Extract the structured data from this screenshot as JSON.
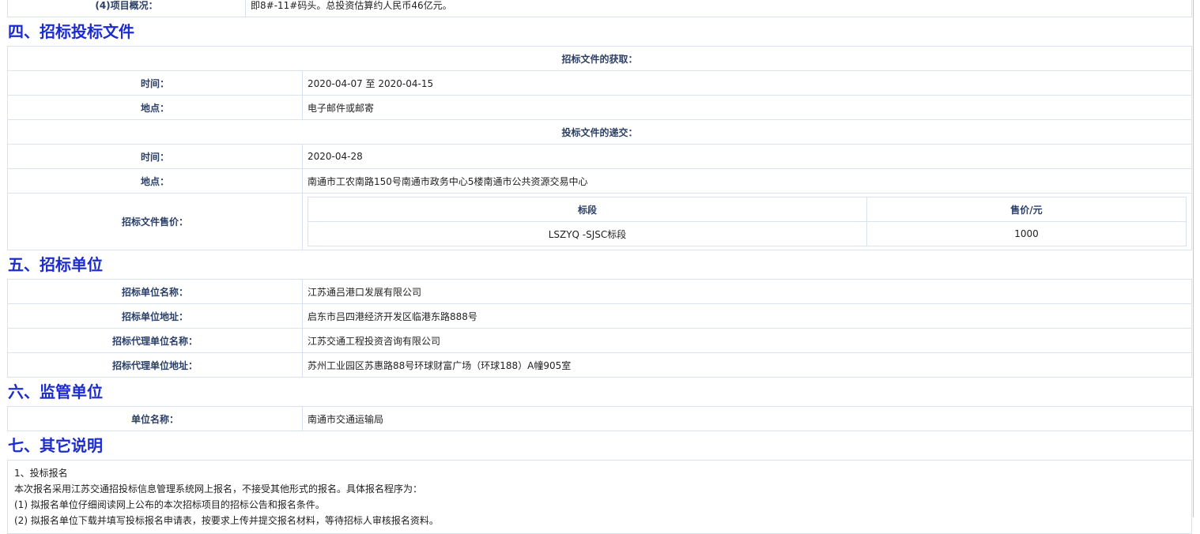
{
  "top_row": {
    "label": "(4)项目概况：",
    "value": "即8#-11#码头。总投资估算约人民币46亿元。"
  },
  "sec4": {
    "title": "四、招标投标文件",
    "obtain_header": "招标文件的获取：",
    "obtain_time_label": "时间：",
    "obtain_time_value": "2020-04-07 至 2020-04-15",
    "obtain_place_label": "地点：",
    "obtain_place_value": "电子邮件或邮寄",
    "submit_header": "投标文件的递交：",
    "submit_time_label": "时间：",
    "submit_time_value": "2020-04-28",
    "submit_place_label": "地点：",
    "submit_place_value": "南通市工农南路150号南通市政务中心5楼南通市公共资源交易中心",
    "price_label": "招标文件售价：",
    "price_table": {
      "col_section": "标段",
      "col_price": "售价/元",
      "row_section": "LSZYQ -SJSC标段",
      "row_price": "1000"
    }
  },
  "sec5": {
    "title": "五、招标单位",
    "name_label": "招标单位名称：",
    "name_value": "江苏通吕港口发展有限公司",
    "addr_label": "招标单位地址：",
    "addr_value": "启东市吕四港经济开发区临港东路888号",
    "agent_label": "招标代理单位名称：",
    "agent_value": "江苏交通工程投资咨询有限公司",
    "agent_addr_label": "招标代理单位地址：",
    "agent_addr_value": "苏州工业园区苏惠路88号环球财富广场（环球188）A幢905室"
  },
  "sec6": {
    "title": "六、监管单位",
    "name_label": "单位名称：",
    "name_value": "南通市交通运输局"
  },
  "sec7": {
    "title": "七、其它说明",
    "line1": "1、投标报名",
    "line2": "本次报名采用江苏交通招投标信息管理系统网上报名，不接受其他形式的报名。具体报名程序为：",
    "line3": "(1) 拟报名单位仔细阅读网上公布的本次招标项目的招标公告和报名条件。",
    "line4": "(2) 拟报名单位下载并填写投标报名申请表，按要求上传并提交报名材料，等待招标人审核报名资料。"
  }
}
